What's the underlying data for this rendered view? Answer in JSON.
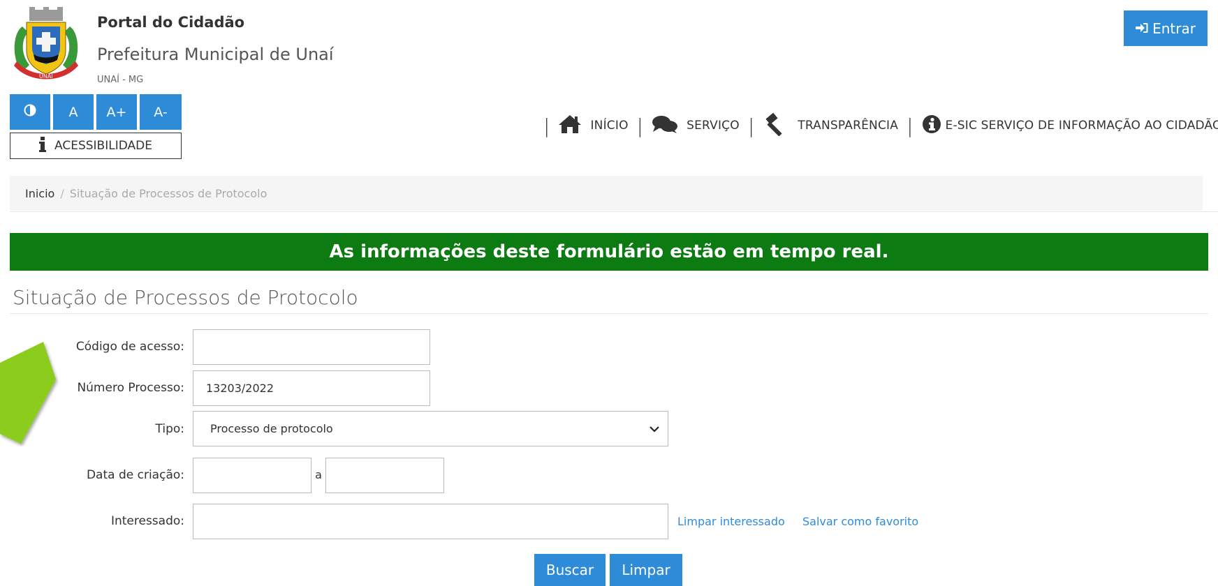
{
  "header": {
    "portal_title": "Portal do Cidadão",
    "pref_name": "Prefeitura Municipal de Unaí",
    "city": "UNAÍ - MG",
    "login_label": "Entrar"
  },
  "accessibility": {
    "contrast_label": "◐",
    "font_normal": "A",
    "font_increase": "A+",
    "font_decrease": "A-",
    "label": "ACESSIBILIDADE"
  },
  "nav": {
    "inicio": "INÍCIO",
    "servico": "SERVIÇO",
    "transparencia": "TRANSPARÊNCIA",
    "esic": "E-SIC SERVIÇO DE INFORMAÇÃO AO CIDADÃO"
  },
  "breadcrumb": {
    "home": "Inicio",
    "separator": "/",
    "current": "Situação de Processos de Protocolo"
  },
  "banner": "As informações deste formulário estão em tempo real.",
  "page_title": "Situação de Processos de Protocolo",
  "form": {
    "codigo_label": "Código de acesso:",
    "codigo_value": "",
    "numero_label": "Número Processo:",
    "numero_value": "13203/2022",
    "tipo_label": "Tipo:",
    "tipo_value": "Processo de protocolo",
    "data_label": "Data de criação:",
    "data_between": "a",
    "data_from": "",
    "data_to": "",
    "interessado_label": "Interessado:",
    "interessado_value": "",
    "limpar_interessado": "Limpar interessado",
    "salvar_favorito": "Salvar como favorito",
    "buscar": "Buscar",
    "limpar": "Limpar"
  },
  "colors": {
    "primary": "#2e8bd8",
    "banner": "#0b7b12",
    "arrow": "#8bcc1a"
  }
}
